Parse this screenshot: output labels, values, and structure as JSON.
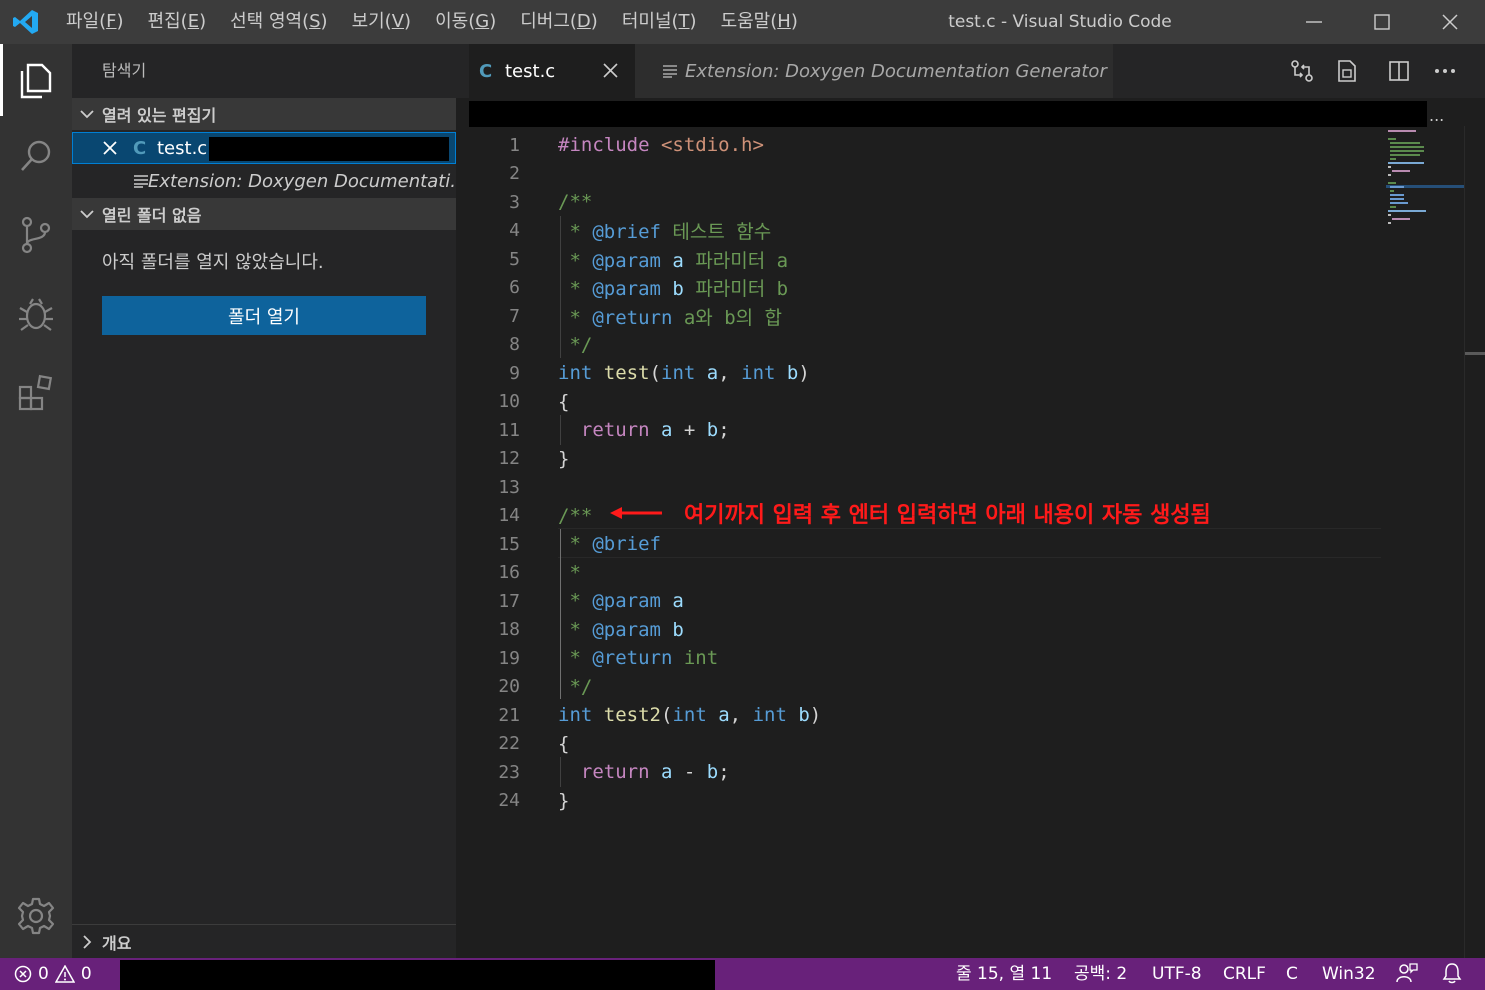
{
  "titlebar": {
    "menu": [
      {
        "label": "파일(",
        "acc": "F",
        "end": ")"
      },
      {
        "label": "편집(",
        "acc": "E",
        "end": ")"
      },
      {
        "label": "선택 영역(",
        "acc": "S",
        "end": ")"
      },
      {
        "label": "보기(",
        "acc": "V",
        "end": ")"
      },
      {
        "label": "이동(",
        "acc": "G",
        "end": ")"
      },
      {
        "label": "디버그(",
        "acc": "D",
        "end": ")"
      },
      {
        "label": "터미널(",
        "acc": "T",
        "end": ")"
      },
      {
        "label": "도움말(",
        "acc": "H",
        "end": ")"
      }
    ],
    "window_title": "test.c - Visual Studio Code"
  },
  "sidebar": {
    "title": "탐색기",
    "open_editors_header": "열려 있는 편집기",
    "open_editors": [
      {
        "lang_badge": "C",
        "name": "test.c"
      },
      {
        "name": "Extension: Doxygen Documentati..."
      }
    ],
    "no_folder_header": "열린 폴더 없음",
    "no_folder_message": "아직 폴더를 열지 않았습니다.",
    "open_folder_button": "폴더 열기",
    "outline_header": "개요"
  },
  "tabs": [
    {
      "badge": "C",
      "label": "test.c"
    },
    {
      "label": "Extension: Doxygen Documentation Generator"
    }
  ],
  "editor": {
    "breadcrumb_more": "...",
    "annotation": "여기까지 입력 후 엔터 입력하면 아래 내용이 자동 생성됨",
    "lines": [
      {
        "n": "1",
        "segs": [
          [
            "pp",
            "#include "
          ],
          [
            "inc",
            "<stdio.h>"
          ]
        ]
      },
      {
        "n": "2",
        "segs": []
      },
      {
        "n": "3",
        "segs": [
          [
            "cm",
            "/**"
          ]
        ]
      },
      {
        "n": "4",
        "segs": [
          [
            "cm",
            " * "
          ],
          [
            "dtag",
            "@brief"
          ],
          [
            "cm",
            " 테스트 함수"
          ]
        ]
      },
      {
        "n": "5",
        "segs": [
          [
            "cm",
            " * "
          ],
          [
            "dtag",
            "@param"
          ],
          [
            "cm",
            " "
          ],
          [
            "var",
            "a"
          ],
          [
            "cm",
            " 파라미터 a"
          ]
        ]
      },
      {
        "n": "6",
        "segs": [
          [
            "cm",
            " * "
          ],
          [
            "dtag",
            "@param"
          ],
          [
            "cm",
            " "
          ],
          [
            "var",
            "b"
          ],
          [
            "cm",
            " 파라미터 b"
          ]
        ]
      },
      {
        "n": "7",
        "segs": [
          [
            "cm",
            " * "
          ],
          [
            "dtag",
            "@return"
          ],
          [
            "cm",
            " a와 b의 합"
          ]
        ]
      },
      {
        "n": "8",
        "segs": [
          [
            "cm",
            " */"
          ]
        ]
      },
      {
        "n": "9",
        "segs": [
          [
            "kw",
            "int"
          ],
          [
            "txt",
            " "
          ],
          [
            "fn",
            "test"
          ],
          [
            "txt",
            "("
          ],
          [
            "kw",
            "int"
          ],
          [
            "txt",
            " "
          ],
          [
            "var",
            "a"
          ],
          [
            "txt",
            ", "
          ],
          [
            "kw",
            "int"
          ],
          [
            "txt",
            " "
          ],
          [
            "var",
            "b"
          ],
          [
            "txt",
            ")"
          ]
        ]
      },
      {
        "n": "10",
        "segs": [
          [
            "txt",
            "{"
          ]
        ]
      },
      {
        "n": "11",
        "segs": [
          [
            "txt",
            "  "
          ],
          [
            "pp",
            "return"
          ],
          [
            "txt",
            " "
          ],
          [
            "var",
            "a"
          ],
          [
            "txt",
            " + "
          ],
          [
            "var",
            "b"
          ],
          [
            "txt",
            ";"
          ]
        ]
      },
      {
        "n": "12",
        "segs": [
          [
            "txt",
            "}"
          ]
        ]
      },
      {
        "n": "13",
        "segs": []
      },
      {
        "n": "14",
        "segs": [
          [
            "cm",
            "/**"
          ]
        ]
      },
      {
        "n": "15",
        "segs": [
          [
            "cm",
            " * "
          ],
          [
            "dtag",
            "@brief"
          ]
        ]
      },
      {
        "n": "16",
        "segs": [
          [
            "cm",
            " *"
          ]
        ]
      },
      {
        "n": "17",
        "segs": [
          [
            "cm",
            " * "
          ],
          [
            "dtag",
            "@param"
          ],
          [
            "cm",
            " "
          ],
          [
            "var",
            "a"
          ]
        ]
      },
      {
        "n": "18",
        "segs": [
          [
            "cm",
            " * "
          ],
          [
            "dtag",
            "@param"
          ],
          [
            "cm",
            " "
          ],
          [
            "var",
            "b"
          ]
        ]
      },
      {
        "n": "19",
        "segs": [
          [
            "cm",
            " * "
          ],
          [
            "dtag",
            "@return"
          ],
          [
            "cm",
            " int"
          ]
        ]
      },
      {
        "n": "20",
        "segs": [
          [
            "cm",
            " */"
          ]
        ]
      },
      {
        "n": "21",
        "segs": [
          [
            "kw",
            "int"
          ],
          [
            "txt",
            " "
          ],
          [
            "fn",
            "test2"
          ],
          [
            "txt",
            "("
          ],
          [
            "kw",
            "int"
          ],
          [
            "txt",
            " "
          ],
          [
            "var",
            "a"
          ],
          [
            "txt",
            ", "
          ],
          [
            "kw",
            "int"
          ],
          [
            "txt",
            " "
          ],
          [
            "var",
            "b"
          ],
          [
            "txt",
            ")"
          ]
        ]
      },
      {
        "n": "22",
        "segs": [
          [
            "txt",
            "{"
          ]
        ]
      },
      {
        "n": "23",
        "segs": [
          [
            "txt",
            "  "
          ],
          [
            "pp",
            "return"
          ],
          [
            "txt",
            " "
          ],
          [
            "var",
            "a"
          ],
          [
            "txt",
            " - "
          ],
          [
            "var",
            "b"
          ],
          [
            "txt",
            ";"
          ]
        ]
      },
      {
        "n": "24",
        "segs": [
          [
            "txt",
            "}"
          ]
        ]
      }
    ]
  },
  "statusbar": {
    "errors": "0",
    "warnings": "0",
    "position": "줄 15, 열 11",
    "indent": "공백: 2",
    "encoding": "UTF-8",
    "eol": "CRLF",
    "language": "C",
    "platform": "Win32"
  },
  "colors": {
    "statusbar": "#68217a",
    "accent_button": "#0e639c",
    "annotation": "#ff1a1a",
    "selection": "#094771"
  }
}
